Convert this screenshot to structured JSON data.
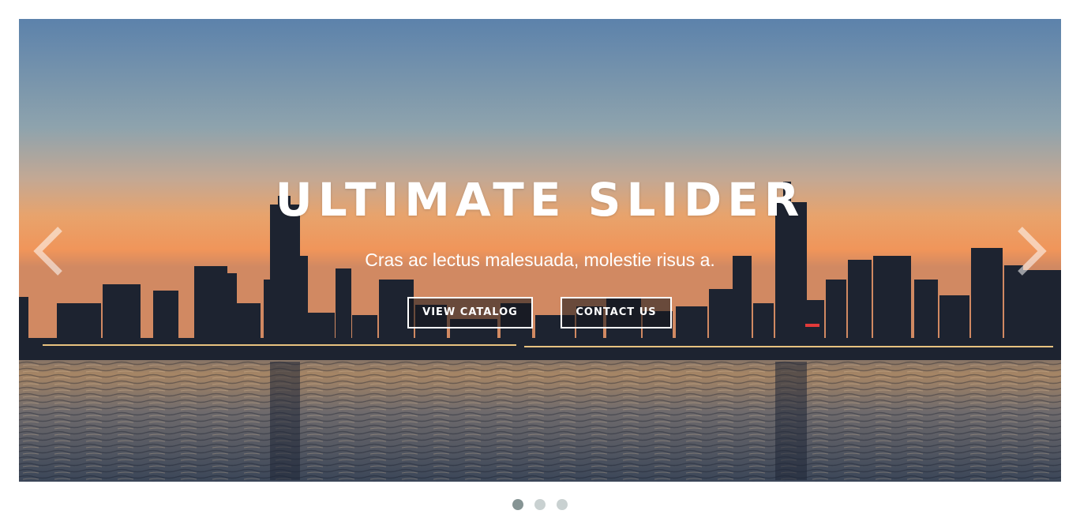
{
  "slider": {
    "title": "ULTIMATE SLIDER",
    "subtitle": "Cras ac lectus malesuada, molestie risus a.",
    "buttons": {
      "view_catalog": "VIEW CATALOG",
      "contact_us": "CONTACT US"
    },
    "prev_icon": "chevron-left-icon",
    "next_icon": "chevron-right-icon",
    "active_slide": 1,
    "slide_count": 3,
    "background": "city skyline at sunset over water"
  },
  "colors": {
    "dot_active": "#869494",
    "dot_inactive": "#c9d1d1",
    "button_border": "#ffffff",
    "text": "#ffffff"
  }
}
